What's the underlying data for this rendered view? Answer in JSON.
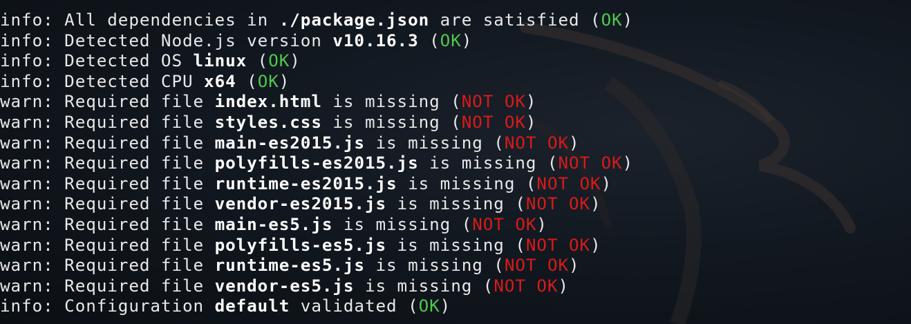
{
  "colors": {
    "background": "#0d1117",
    "text": "#e8e8e8",
    "ok": "#4ec94e",
    "not_ok": "#d91a1a"
  },
  "lines": [
    {
      "level": "info:",
      "pre": " All dependencies in ",
      "bold": "./package.json",
      "post": " are satisfied (",
      "status": "OK",
      "status_type": "ok",
      "end": ")"
    },
    {
      "level": "info:",
      "pre": " Detected Node.js version ",
      "bold": "v10.16.3",
      "post": " (",
      "status": "OK",
      "status_type": "ok",
      "end": ")"
    },
    {
      "level": "info:",
      "pre": " Detected OS ",
      "bold": "linux",
      "post": " (",
      "status": "OK",
      "status_type": "ok",
      "end": ")"
    },
    {
      "level": "info:",
      "pre": " Detected CPU ",
      "bold": "x64",
      "post": " (",
      "status": "OK",
      "status_type": "ok",
      "end": ")"
    },
    {
      "level": "warn:",
      "pre": " Required file ",
      "bold": "index.html",
      "post": " is missing (",
      "status": "NOT OK",
      "status_type": "notok",
      "end": ")"
    },
    {
      "level": "warn:",
      "pre": " Required file ",
      "bold": "styles.css",
      "post": " is missing (",
      "status": "NOT OK",
      "status_type": "notok",
      "end": ")"
    },
    {
      "level": "warn:",
      "pre": " Required file ",
      "bold": "main-es2015.js",
      "post": " is missing (",
      "status": "NOT OK",
      "status_type": "notok",
      "end": ")"
    },
    {
      "level": "warn:",
      "pre": " Required file ",
      "bold": "polyfills-es2015.js",
      "post": " is missing (",
      "status": "NOT OK",
      "status_type": "notok",
      "end": ")"
    },
    {
      "level": "warn:",
      "pre": " Required file ",
      "bold": "runtime-es2015.js",
      "post": " is missing (",
      "status": "NOT OK",
      "status_type": "notok",
      "end": ")"
    },
    {
      "level": "warn:",
      "pre": " Required file ",
      "bold": "vendor-es2015.js",
      "post": " is missing (",
      "status": "NOT OK",
      "status_type": "notok",
      "end": ")"
    },
    {
      "level": "warn:",
      "pre": " Required file ",
      "bold": "main-es5.js",
      "post": " is missing (",
      "status": "NOT OK",
      "status_type": "notok",
      "end": ")"
    },
    {
      "level": "warn:",
      "pre": " Required file ",
      "bold": "polyfills-es5.js",
      "post": " is missing (",
      "status": "NOT OK",
      "status_type": "notok",
      "end": ")"
    },
    {
      "level": "warn:",
      "pre": " Required file ",
      "bold": "runtime-es5.js",
      "post": " is missing (",
      "status": "NOT OK",
      "status_type": "notok",
      "end": ")"
    },
    {
      "level": "warn:",
      "pre": " Required file ",
      "bold": "vendor-es5.js",
      "post": " is missing (",
      "status": "NOT OK",
      "status_type": "notok",
      "end": ")"
    },
    {
      "level": "info:",
      "pre": " Configuration ",
      "bold": "default",
      "post": " validated (",
      "status": "OK",
      "status_type": "ok",
      "end": ")"
    }
  ]
}
